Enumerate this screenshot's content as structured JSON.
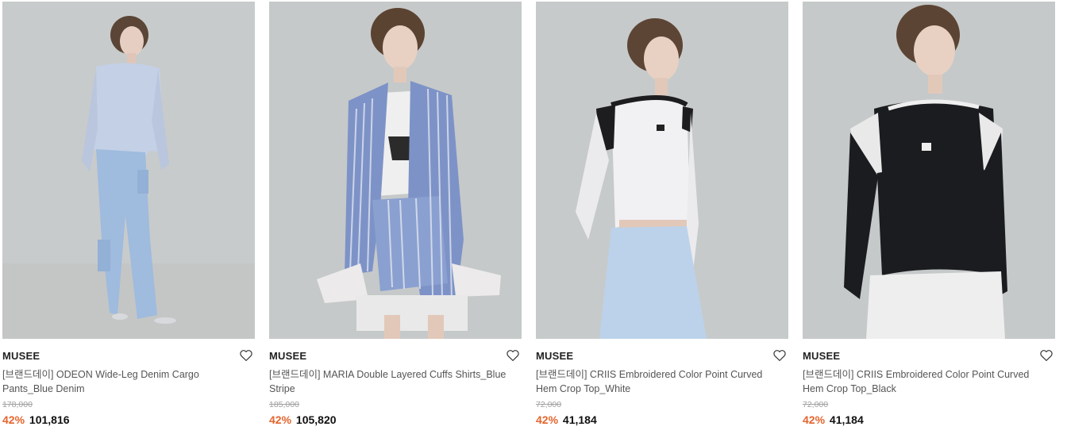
{
  "colors": {
    "discount": "#e4652d",
    "photo_bg": "#c9cccc"
  },
  "products": [
    {
      "brand": "MUSEE",
      "title": "[브랜드데이] ODEON Wide-Leg Denim Cargo Pants_Blue Denim",
      "original_price": "178,000",
      "discount": "42%",
      "price": "101,816",
      "wishlist_icon": "heart-outline-icon"
    },
    {
      "brand": "MUSEE",
      "title": "[브랜드데이] MARIA Double Layered Cuffs Shirts_Blue Stripe",
      "original_price": "185,000",
      "discount": "42%",
      "price": "105,820",
      "wishlist_icon": "heart-outline-icon"
    },
    {
      "brand": "MUSEE",
      "title": "[브랜드데이] CRIIS Embroidered Color Point Curved Hem Crop Top_White",
      "original_price": "72,000",
      "discount": "42%",
      "price": "41,184",
      "wishlist_icon": "heart-outline-icon"
    },
    {
      "brand": "MUSEE",
      "title": "[브랜드데이] CRIIS Embroidered Color Point Curved Hem Crop Top_Black",
      "original_price": "72,000",
      "discount": "42%",
      "price": "41,184",
      "wishlist_icon": "heart-outline-icon"
    }
  ]
}
